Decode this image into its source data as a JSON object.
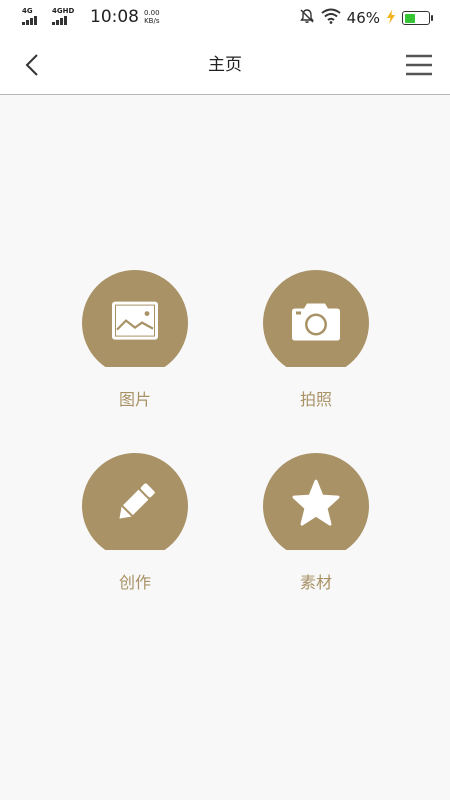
{
  "statusbar": {
    "net1": "4G",
    "net2": "4GHD",
    "time": "10:08",
    "speed_value": "0.00",
    "speed_unit": "KB/s",
    "battery_pct": "46%",
    "battery_level": 0.46
  },
  "navbar": {
    "title": "主页"
  },
  "tiles": [
    {
      "label": "图片",
      "icon": "image-icon"
    },
    {
      "label": "拍照",
      "icon": "camera-icon"
    },
    {
      "label": "创作",
      "icon": "pencil-icon"
    },
    {
      "label": "素材",
      "icon": "star-icon"
    }
  ],
  "colors": {
    "accent": "#a89266",
    "background": "#f8f8f8",
    "battery": "#35c535"
  }
}
